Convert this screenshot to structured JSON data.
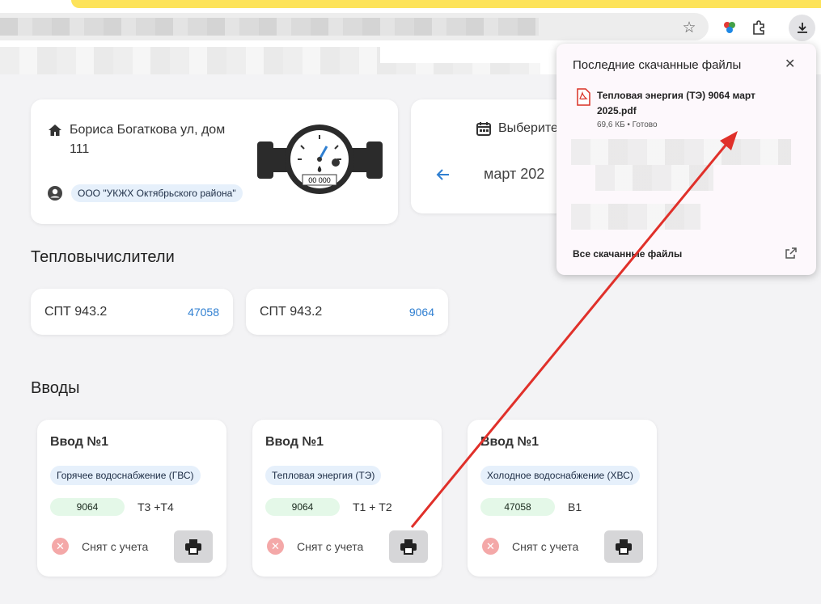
{
  "browser": {
    "icons": [
      "star-icon",
      "extension-colored-icon",
      "puzzle-icon",
      "download-icon"
    ]
  },
  "address_card": {
    "address": "Бориса Богаткова ул, дом 111",
    "organization": "ООО \"УКЖХ Октябрьского района\"",
    "meter_display": "00 000"
  },
  "date_card": {
    "label": "Выберите",
    "month": "март 202"
  },
  "sections": {
    "calculators_title": "Тепловычислители",
    "inputs_title": "Вводы"
  },
  "calculators": [
    {
      "name": "СПТ 943.2",
      "number": "47058"
    },
    {
      "name": "СПТ 943.2",
      "number": "9064"
    }
  ],
  "inputs": [
    {
      "title": "Ввод №1",
      "type": "Горячее водоснабжение (ГВС)",
      "number": "9064",
      "lines": "Т3 +Т4",
      "status": "Снят с учета"
    },
    {
      "title": "Ввод №1",
      "type": "Тепловая энергия (ТЭ)",
      "number": "9064",
      "lines": "Т1 + Т2",
      "status": "Снят с учета"
    },
    {
      "title": "Ввод №1",
      "type": "Холодное водоснабжение (ХВС)",
      "number": "47058",
      "lines": "В1",
      "status": "Снят с учета"
    }
  ],
  "downloads": {
    "title": "Последние скачанные файлы",
    "file_name": "Тепловая энергия (ТЭ) 9064 март 2025.pdf",
    "file_meta": "69,6 КБ • Готово",
    "all_label": "Все скачанные файлы"
  },
  "colors": {
    "accent_blue": "#2f7fd1",
    "arrow_red": "#e0302a",
    "chip_blue": "#e6f0fb",
    "chip_green": "#e4f8e8"
  }
}
